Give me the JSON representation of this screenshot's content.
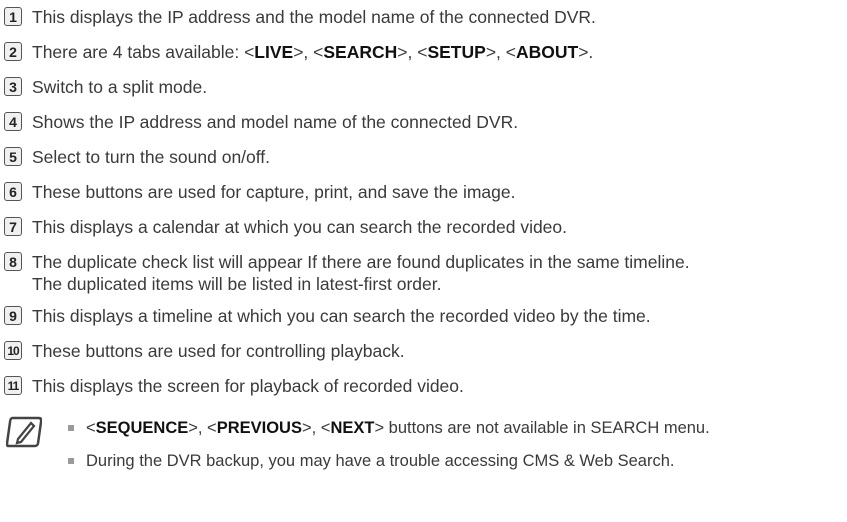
{
  "items": [
    {
      "num": "1",
      "text": "This displays the IP address and the model name of the connected DVR."
    },
    {
      "num": "2",
      "parts": [
        "There are 4 tabs available: <",
        "LIVE",
        ">, <",
        "SEARCH",
        ">, <",
        "SETUP",
        ">, <",
        "ABOUT",
        ">."
      ]
    },
    {
      "num": "3",
      "text": "Switch to a split mode."
    },
    {
      "num": "4",
      "text": "Shows the IP address and model name of the connected DVR."
    },
    {
      "num": "5",
      "text": "Select to turn the sound on/off."
    },
    {
      "num": "6",
      "text": "These buttons are used for capture, print, and save the image."
    },
    {
      "num": "7",
      "text": "This displays a calendar at which you can search the recorded video."
    },
    {
      "num": "8",
      "line1": "The duplicate check list will appear If there are found duplicates in the same timeline.",
      "line2": "The duplicated items will be listed in latest-first order."
    },
    {
      "num": "9",
      "text": "This displays a timeline at which you can search the recorded video by the time."
    },
    {
      "num": "10",
      "text": "These buttons are used for controlling playback."
    },
    {
      "num": "11",
      "text": "This displays the screen for playback of recorded video."
    }
  ],
  "notes": {
    "icon": "note-pencil-icon",
    "note1": [
      "<",
      "SEQUENCE",
      ">, <",
      "PREVIOUS",
      ">, <",
      "NEXT",
      "> buttons are not available in SEARCH menu."
    ],
    "note2": "During the DVR backup, you may have a trouble accessing CMS & Web Search."
  }
}
